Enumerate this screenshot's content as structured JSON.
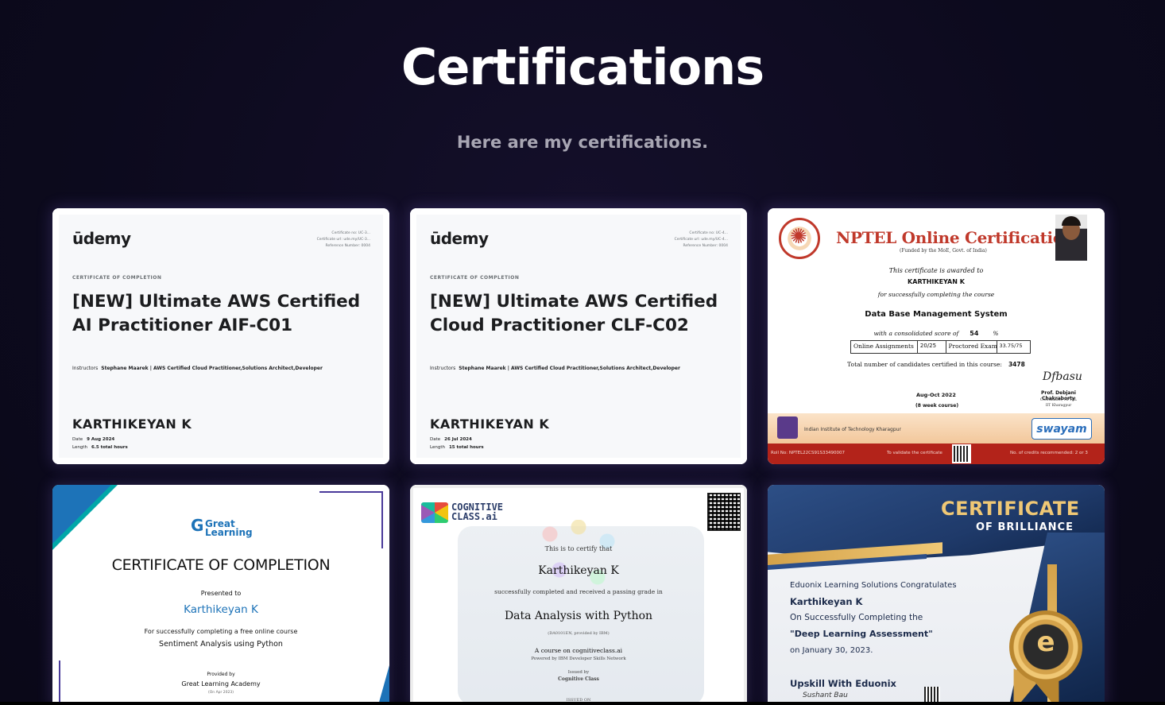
{
  "header": {
    "title": "Certifications",
    "subtitle": "Here are my certifications."
  },
  "cards": {
    "udemy_ai": {
      "logo": "ūdemy",
      "refs": [
        "Certificate no: UC-3...",
        "Certificate url: ude.my/UC-3...",
        "Reference Number: 0004"
      ],
      "kicker": "CERTIFICATE OF COMPLETION",
      "course": "[NEW] Ultimate AWS Certified AI Practitioner AIF-C01",
      "instructors_label": "Instructors",
      "instructors": "Stephane Maarek | AWS Certified Cloud Practitioner,Solutions Architect,Developer",
      "name": "KARTHIKEYAN K",
      "date_label": "Date",
      "date": "9 Aug 2024",
      "length_label": "Length",
      "length": "6.5 total hours"
    },
    "udemy_cloud": {
      "logo": "ūdemy",
      "refs": [
        "Certificate no: UC-4...",
        "Certificate url: ude.my/UC-4...",
        "Reference Number: 0004"
      ],
      "kicker": "CERTIFICATE OF COMPLETION",
      "course": "[NEW] Ultimate AWS Certified Cloud Practitioner CLF-C02",
      "instructors_label": "Instructors",
      "instructors": "Stephane Maarek | AWS Certified Cloud Practitioner,Solutions Architect,Developer",
      "name": "KARTHIKEYAN K",
      "date_label": "Date",
      "date": "26 Jul 2024",
      "length_label": "Length",
      "length": "15 total hours"
    },
    "nptel": {
      "title": "NPTEL Online Certification",
      "funded": "(Funded by the MoE, Govt. of India)",
      "awarded": "This certificate is awarded to",
      "name": "KARTHIKEYAN K",
      "succ": "for successfully completing the course",
      "course": "Data Base Management System",
      "score_label": "with a consolidated score of",
      "score": "54",
      "score_unit": "%",
      "table": [
        "Online Assignments",
        "20/25",
        "Proctored Exam",
        "33.75/75"
      ],
      "total_label": "Total number of candidates certified in this course:",
      "total": "3478",
      "date": "Aug-Oct 2022",
      "duration": "(8 week course)",
      "signature": "Dfbasu",
      "prof": "Prof. Debjani Chakraborty",
      "prof_role": "Coordinator, NPTEL",
      "prof_org": "IIT Kharagpur",
      "institute": "Indian Institute of Technology Kharagpur",
      "swayam": "swayam",
      "roll": "Roll No: NPTEL22CS91S33490007",
      "validate": "To validate the certificate",
      "credits": "No. of credits recommended: 2 or 3"
    },
    "great_learning": {
      "logo_line1": "Great",
      "logo_line2": "Learning",
      "logo_g": "G",
      "cert": "CERTIFICATE OF COMPLETION",
      "presented": "Presented to",
      "name": "Karthikeyan K",
      "for": "For successfully completing a free online course",
      "course": "Sentiment Analysis using Python",
      "provided": "Provided by",
      "academy": "Great Learning Academy",
      "date": "(On Apr 2023)"
    },
    "cognitive": {
      "logo_line1": "COGNITIVE",
      "logo_line2": "CLASS.ai",
      "l1": "This is to certify that",
      "name": "Karthikeyan K",
      "l2": "successfully completed and received a passing grade in",
      "course": "Data Analysis with Python",
      "l3": "(DA0101EN, provided by IBM)",
      "l4": "A course on cognitiveclass.ai",
      "l5": "Powered by IBM Developer Skills Network",
      "l6": "Issued by",
      "l7": "Cognitive Class",
      "l8": "ISSUED ON"
    },
    "eduonix": {
      "title": "CERTIFICATE",
      "sub": "OF BRILLIANCE",
      "l1": "Eduonix Learning Solutions Congratulates",
      "name": "Karthikeyan K",
      "l3": "On Successfully Completing the",
      "course": "\"Deep Learning Assessment\"",
      "date": "on January 30, 2023.",
      "tagline": "Upskill With Eduonix",
      "signature": "Sushant Bau",
      "medal": "e"
    }
  },
  "colors": {
    "background": "#0c0a1d",
    "udemy_purple": "#a435f0",
    "nptel_red": "#c0392b",
    "gl_blue": "#1d73b8",
    "eduonix_gold": "#f0c875"
  }
}
